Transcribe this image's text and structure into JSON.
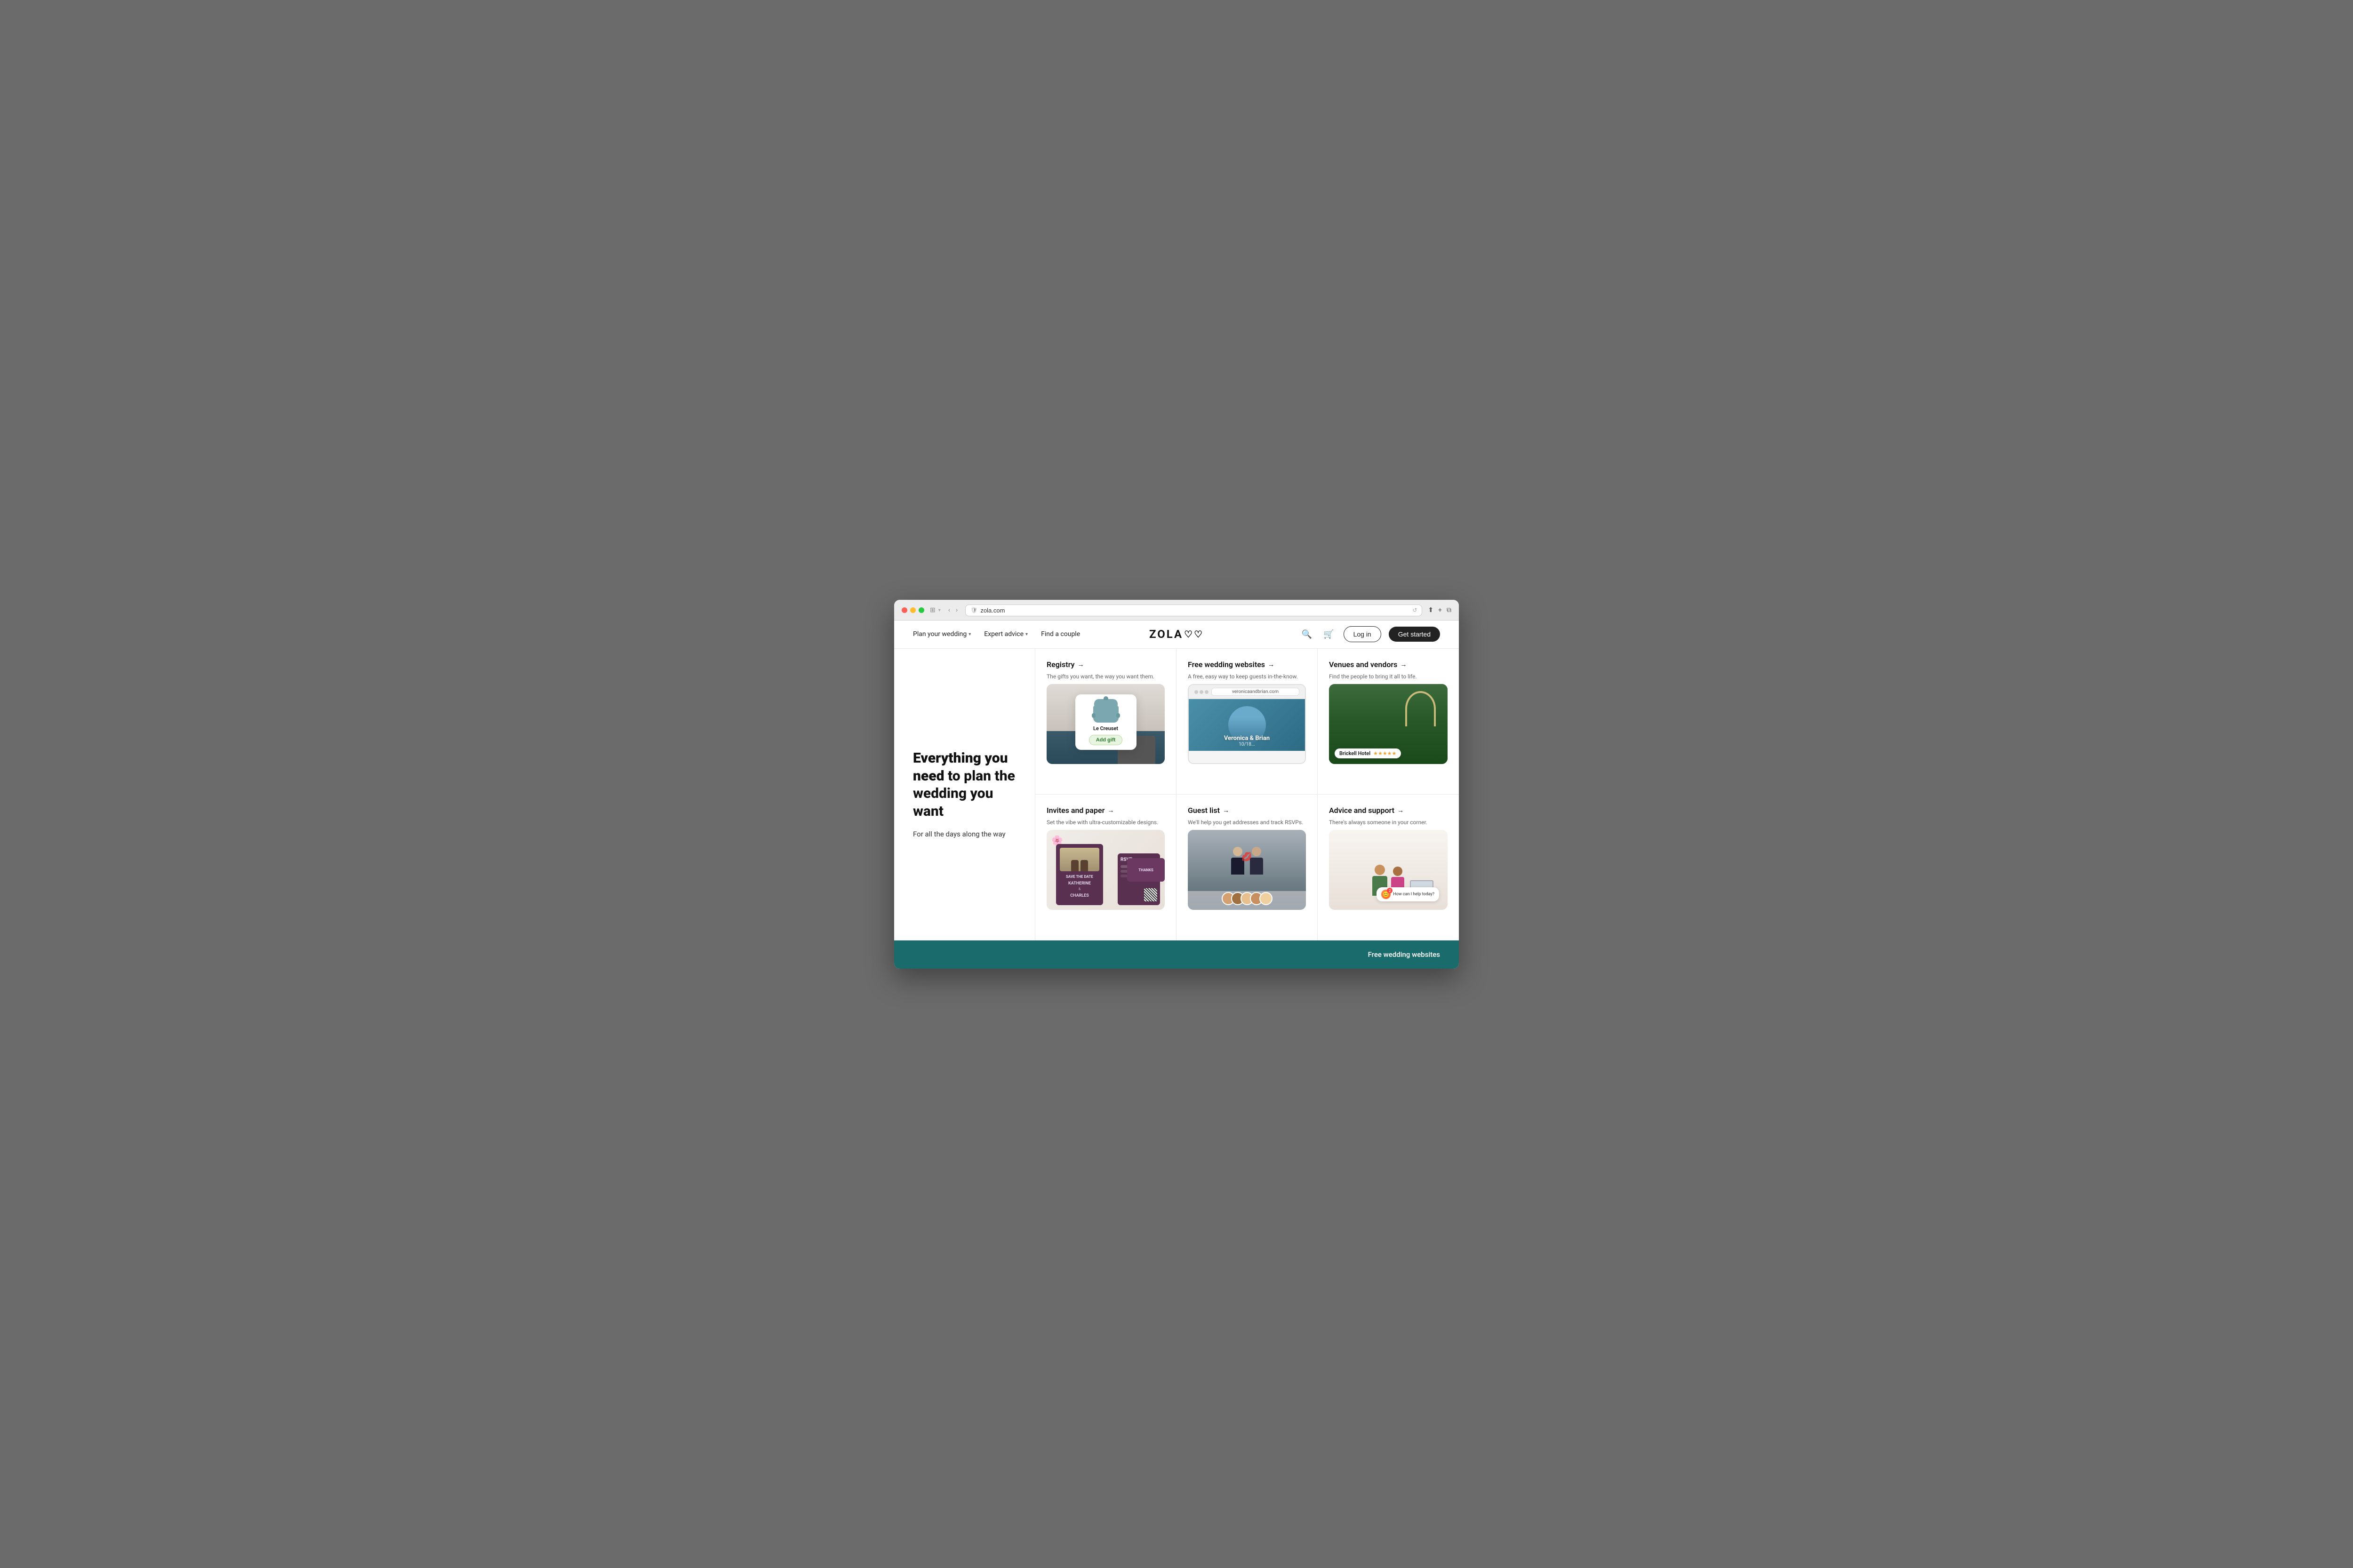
{
  "browser": {
    "address": "zola.com",
    "reload_icon": "↺"
  },
  "nav": {
    "plan_wedding": "Plan your wedding",
    "expert_advice": "Expert advice",
    "find_couple": "Find a couple",
    "logo": "ZOLA",
    "logo_hearts": "♡♡",
    "login": "Log in",
    "get_started": "Get started"
  },
  "hero": {
    "title_bold": "Everything you need",
    "title_regular": " to plan the wedding you want",
    "subtitle": "For all the days along the way"
  },
  "grid": {
    "cells": [
      {
        "id": "registry",
        "title": "Registry",
        "arrow": "→",
        "description": "The gifts you want, the way you want them.",
        "card_label": "Le Creuset",
        "add_gift": "Add gift"
      },
      {
        "id": "wedding-websites",
        "title": "Free wedding websites",
        "arrow": "→",
        "description": "A free, easy way to keep guests in-the-know.",
        "url": "veronicaandbrian.com",
        "couple_names": "Veronica & Brian",
        "couple_date": "10/18..."
      },
      {
        "id": "venues-vendors",
        "title": "Venues and vendors",
        "arrow": "→",
        "description": "Find the people to bring it all to life.",
        "venue_name": "Brickell Hotel",
        "stars": "★★★★★"
      },
      {
        "id": "invites-paper",
        "title": "Invites and paper",
        "arrow": "→",
        "description": "Set the vibe with ultra-customizable designs.",
        "couple_katherine": "KATHERINE",
        "couple_charles": "CHARLES",
        "save_date": "SAVE THE DATE",
        "rsvp": "RSVP",
        "thanks": "THANKS"
      },
      {
        "id": "guest-list",
        "title": "Guest list",
        "arrow": "→",
        "description": "We'll help you get addresses and track RSVPs."
      },
      {
        "id": "advice-support",
        "title": "Advice and support",
        "arrow": "→",
        "description": "There's always someone in your corner.",
        "chat_message": "How can I help today?"
      }
    ]
  },
  "footer": {
    "link_text": "Free wedding websites"
  }
}
